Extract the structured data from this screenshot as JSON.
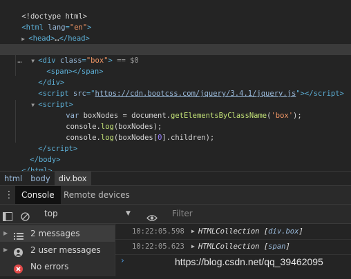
{
  "elements": {
    "doctype": "<!doctype html>",
    "html_open_tag": "html",
    "html_lang_attr": "lang",
    "html_lang_value": "\"en\"",
    "head_collapsed": "head",
    "head_ellipsis": "…",
    "body_open": "body",
    "div_tag": "div",
    "div_class_attr": "class",
    "div_class_value": "\"box\"",
    "div_eq": " == $0",
    "span_tag": "span",
    "script_tag": "script",
    "script_src_attr": "src",
    "script_src_url": "https://cdn.bootcss.com/jquery/3.4.1/jquery.js",
    "code_line1_kw": "var",
    "code_line1_a": " boxNodes = document.",
    "code_line1_fn": "getElementsByClassName",
    "code_line1_b": "(",
    "code_line1_str": "'box'",
    "code_line1_c": ");",
    "code_line2_a": "console.",
    "code_line2_fn": "log",
    "code_line2_b": "(boxNodes);",
    "code_line3_a": "console.",
    "code_line3_fn": "log",
    "code_line3_b": "(boxNodes[",
    "code_line3_num": "0",
    "code_line3_c": "].children);"
  },
  "breadcrumbs": [
    "html",
    "body",
    "div.box"
  ],
  "drawer_tabs": [
    "Console",
    "Remote devices"
  ],
  "toolbar": {
    "context": "top",
    "filter_placeholder": "Filter"
  },
  "sidebar": {
    "items": [
      {
        "label": "2 messages",
        "icon": "list-icon"
      },
      {
        "label": "2 user messages",
        "icon": "user-icon"
      },
      {
        "label": "No errors",
        "icon": "error-icon"
      }
    ]
  },
  "console": {
    "messages": [
      {
        "time": "10:22:05.598",
        "type": "HTMLCollection",
        "detail_open": " [",
        "detail": "div.box",
        "detail_close": "]"
      },
      {
        "time": "10:22:05.623",
        "type": "HTMLCollection",
        "detail_open": " [",
        "detail": "span",
        "detail_close": "]"
      }
    ],
    "prompt": "›"
  },
  "watermark": "https://blog.csdn.net/qq_39462095",
  "colors": {
    "background": "#242424",
    "tag": "#5db0d7",
    "attr_value": "#f29766",
    "error": "#e24a4a",
    "prompt": "#4e9be0"
  }
}
